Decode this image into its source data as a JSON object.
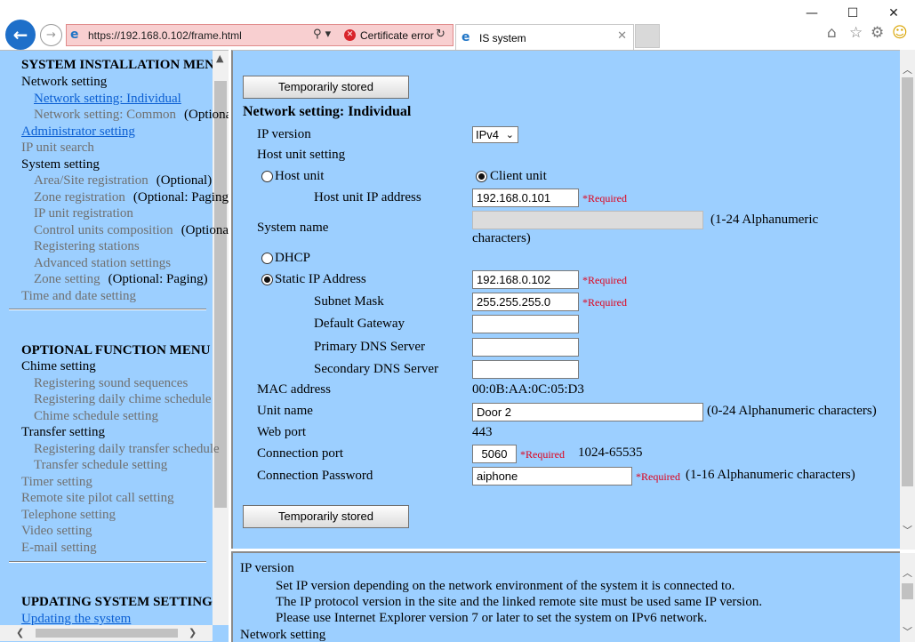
{
  "window": {
    "minimize": "—",
    "maximize": "☐",
    "close": "✕"
  },
  "browser": {
    "url": "https://192.168.0.102/frame.html",
    "cert_error": "Certificate error",
    "tab_title": "IS system",
    "icons": [
      "back-arrow-icon",
      "forward-arrow-icon",
      "ie-logo-icon",
      "search-icon",
      "certificate-error-icon",
      "refresh-icon",
      "home-icon",
      "favorites-star-icon",
      "settings-gear-icon",
      "smiley-feedback-icon"
    ]
  },
  "sidebar": {
    "heading1": "SYSTEM INSTALLATION MENU",
    "items1": [
      {
        "label": "Network setting",
        "style": "plain"
      },
      {
        "label": "Network setting: Individual",
        "style": "link"
      },
      {
        "label": "Network setting: Common",
        "suffix": "(Optional)",
        "style": "gray"
      },
      {
        "label": "Administrator setting",
        "style": "link"
      },
      {
        "label": "IP unit search",
        "style": "gray"
      },
      {
        "label": "System setting",
        "style": "plain"
      },
      {
        "label": "Area/Site registration",
        "suffix": "(Optional)",
        "style": "gray"
      },
      {
        "label": "Zone registration",
        "suffix": "(Optional: Paging)",
        "style": "gray"
      },
      {
        "label": "IP unit registration",
        "style": "gray"
      },
      {
        "label": "Control units composition",
        "suffix": "(Optional)",
        "style": "gray"
      },
      {
        "label": "Registering stations",
        "style": "gray"
      },
      {
        "label": "Advanced station settings",
        "style": "gray"
      },
      {
        "label": "Zone setting",
        "suffix": "(Optional: Paging)",
        "style": "gray"
      },
      {
        "label": "Time and date setting",
        "style": "gray"
      }
    ],
    "heading2": "OPTIONAL FUNCTION MENU",
    "items2": [
      {
        "label": "Chime setting",
        "style": "plain"
      },
      {
        "label": "Registering sound sequences",
        "style": "gray"
      },
      {
        "label": "Registering daily chime schedule",
        "style": "gray"
      },
      {
        "label": "Chime schedule setting",
        "style": "gray"
      },
      {
        "label": "Transfer setting",
        "style": "plain"
      },
      {
        "label": "Registering daily transfer schedule",
        "style": "gray"
      },
      {
        "label": "Transfer schedule setting",
        "style": "gray"
      },
      {
        "label": "Timer setting",
        "style": "gray"
      },
      {
        "label": "Remote site pilot call setting",
        "style": "gray"
      },
      {
        "label": "Telephone setting",
        "style": "gray"
      },
      {
        "label": "Video setting",
        "style": "gray"
      },
      {
        "label": "E-mail setting",
        "style": "gray"
      }
    ],
    "heading3": "UPDATING SYSTEM SETTINGS",
    "items3": [
      {
        "label": "Updating the system",
        "style": "link"
      }
    ]
  },
  "main": {
    "store_button": "Temporarily stored",
    "page_title": "Network setting: Individual",
    "ip_version_label": "IP version",
    "ip_version_value": "IPv4",
    "host_unit_setting_label": "Host unit setting",
    "host_unit_radio": "Host unit",
    "client_unit_radio": "Client unit",
    "host_unit_selected": "Client unit",
    "host_ip_label": "Host unit IP address",
    "host_ip_value": "192.168.0.101",
    "required": "*Required",
    "system_name_label": "System name",
    "system_name_value": "",
    "system_name_hint": "(1-24 Alphanumeric characters)",
    "dhcp_radio": "DHCP",
    "static_radio": "Static IP Address",
    "address_mode_selected": "Static IP Address",
    "static_ip_value": "192.168.0.102",
    "subnet_label": "Subnet Mask",
    "subnet_value": "255.255.255.0",
    "gateway_label": "Default Gateway",
    "gateway_value": "",
    "dns1_label": "Primary DNS Server",
    "dns1_value": "",
    "dns2_label": "Secondary DNS Server",
    "dns2_value": "",
    "mac_label": "MAC address",
    "mac_value": "00:0B:AA:0C:05:D3",
    "unit_name_label": "Unit name",
    "unit_name_value": "Door 2",
    "unit_name_hint": "(0-24 Alphanumeric characters)",
    "web_port_label": "Web port",
    "web_port_value": "443",
    "conn_port_label": "Connection port",
    "conn_port_value": "5060",
    "conn_port_range": "1024-65535",
    "conn_pw_label": "Connection Password",
    "conn_pw_value": "aiphone",
    "conn_pw_hint": "(1-16 Alphanumeric characters)"
  },
  "help": {
    "title": "IP version",
    "lines": [
      "Set IP version depending on the network environment of the system it is connected to.",
      "The IP protocol version in the site and the linked remote site must be used same IP version.",
      "Please use Internet Explorer version 7 or later to set the system on IPv6 network."
    ],
    "next_title": "Network setting"
  }
}
